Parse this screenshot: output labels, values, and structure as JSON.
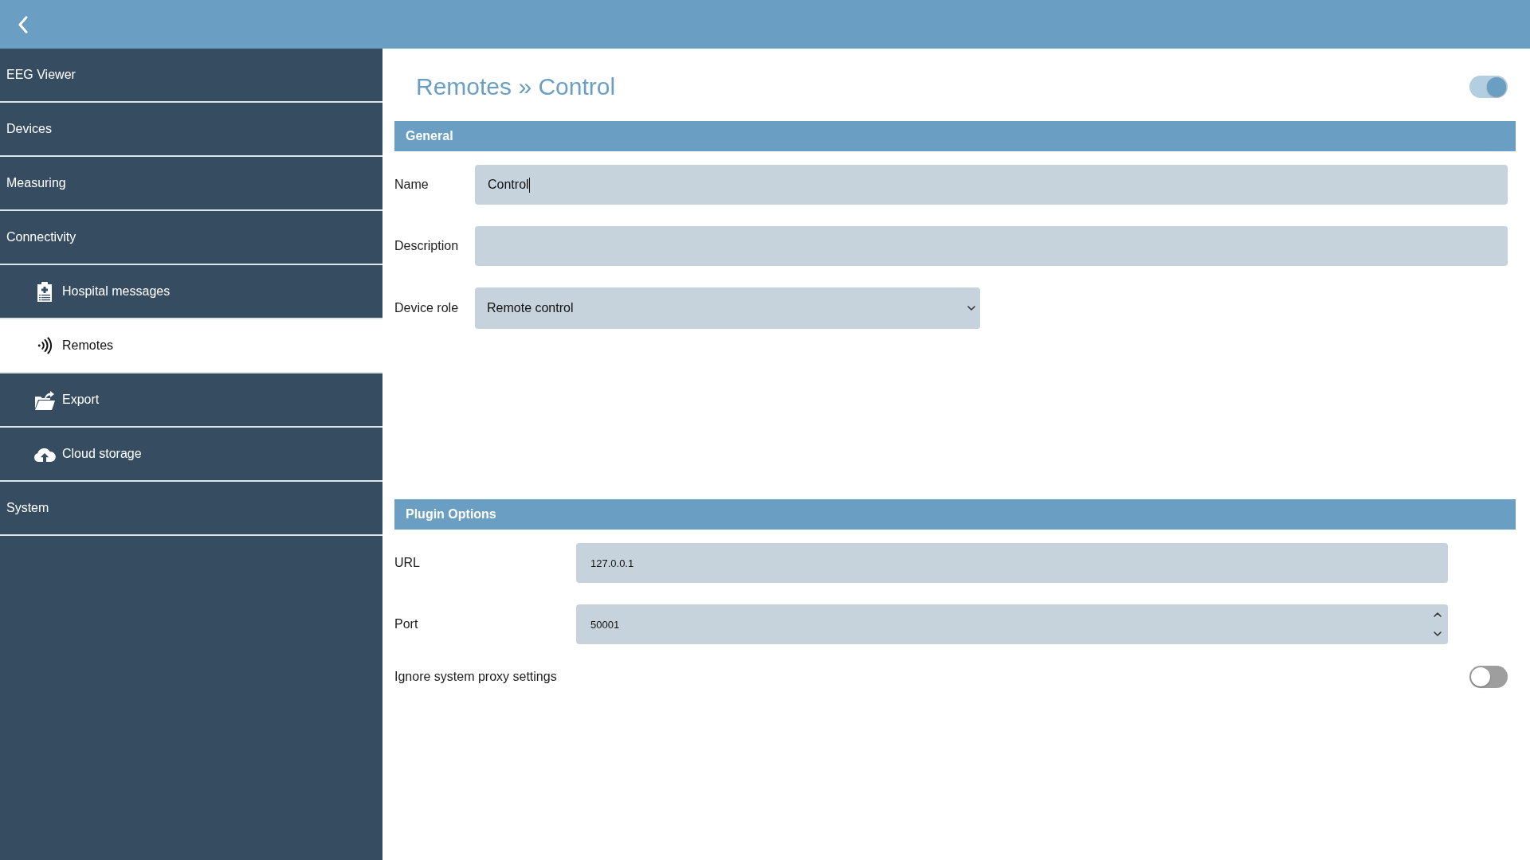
{
  "sidebar": {
    "items": [
      {
        "label": "EEG Viewer",
        "selected": false
      },
      {
        "label": "Devices",
        "selected": false
      },
      {
        "label": "Measuring",
        "selected": false
      },
      {
        "label": "Connectivity",
        "selected": false,
        "children": [
          {
            "label": "Hospital messages",
            "selected": false
          },
          {
            "label": "Remotes",
            "selected": true
          },
          {
            "label": "Export",
            "selected": false
          },
          {
            "label": "Cloud storage",
            "selected": false
          }
        ]
      },
      {
        "label": "System",
        "selected": false
      }
    ]
  },
  "page": {
    "title": "Remotes » Control",
    "enabled": {
      "on": true
    }
  },
  "sections": [
    {
      "title": "General",
      "fields": [
        {
          "kind": "text",
          "label": "Name",
          "value": "Control",
          "focused": true
        },
        {
          "kind": "text",
          "label": "Description",
          "focused": false
        },
        {
          "kind": "select",
          "label": "Device role",
          "value": "Remote control"
        }
      ]
    },
    {
      "title": "Plugin Options",
      "fields": [
        {
          "kind": "text",
          "label": "URL",
          "value": "127.0.0.1",
          "focused": false
        },
        {
          "kind": "number",
          "label": "Port",
          "value": "50001",
          "focused": false
        },
        {
          "kind": "switch",
          "label": "Ignore system proxy settings",
          "on": false
        }
      ]
    }
  ]
}
